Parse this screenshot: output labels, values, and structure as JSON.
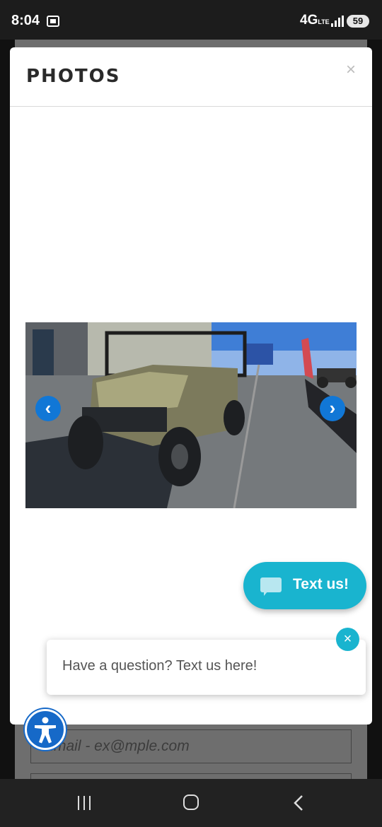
{
  "status_bar": {
    "time": "8:04",
    "network": "4G",
    "network_sub": "LTE",
    "battery": "59"
  },
  "background_form": {
    "email_placeholder": "Email - ex@mple.com"
  },
  "modal": {
    "title": "PHOTOS",
    "close_label": "×",
    "prev_label": "‹",
    "next_label": "›"
  },
  "chat_widget": {
    "button_label": "Text us!",
    "prompt_text": "Have a question? Text us here!",
    "close_label": "×",
    "accent_color": "#19b4cf"
  },
  "accessibility": {
    "icon": "accessibility-icon"
  },
  "system_nav": {
    "recent": "recent-apps-icon",
    "home": "home-icon",
    "back": "back-icon"
  }
}
